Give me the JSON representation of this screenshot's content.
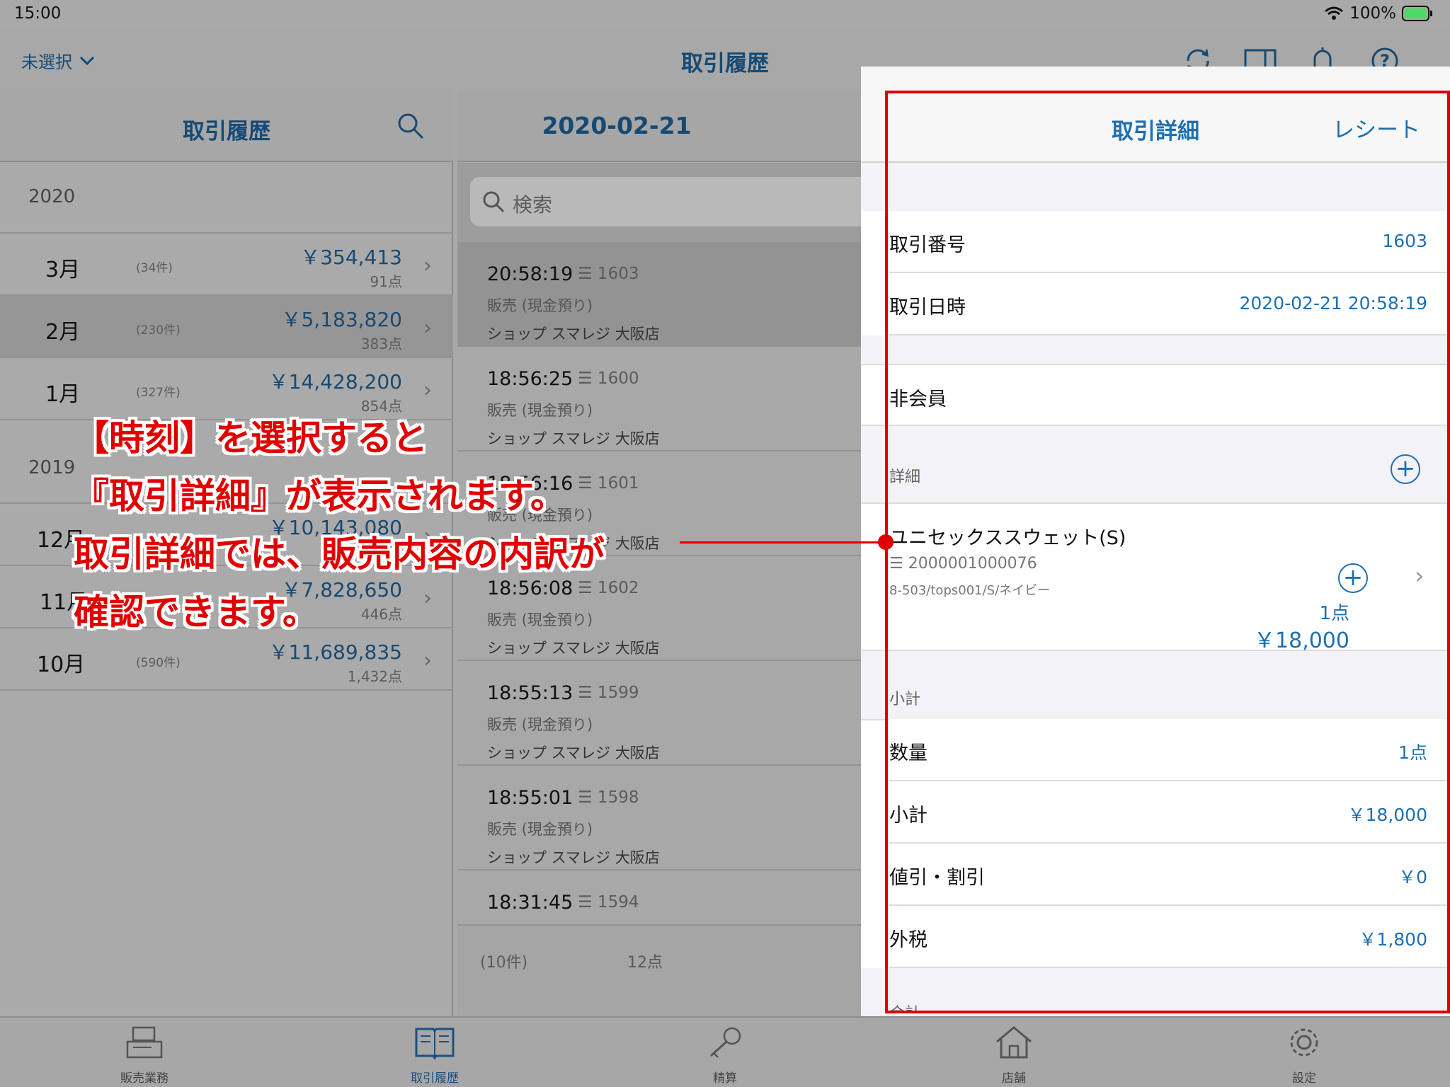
{
  "status": {
    "time": "15:00",
    "battery": "100%"
  },
  "nav": {
    "selector": "未選択",
    "title": "取引履歴",
    "icons": [
      "refresh-icon",
      "split-view-icon",
      "bell-icon",
      "help-icon"
    ]
  },
  "months": {
    "header": "取引履歴",
    "year2020": "2020",
    "year2019": "2019",
    "rows2020": [
      {
        "month": "3月",
        "count": "(34件)",
        "amount": "￥354,413",
        "points": "91点"
      },
      {
        "month": "2月",
        "count": "(230件)",
        "amount": "￥5,183,820",
        "points": "383点"
      },
      {
        "month": "1月",
        "count": "(327件)",
        "amount": "￥14,428,200",
        "points": "854点"
      }
    ],
    "rows2019": [
      {
        "month": "12月",
        "count": "",
        "amount": "￥10,143,080",
        "points": ""
      },
      {
        "month": "11月",
        "count": "",
        "amount": "￥7,828,650",
        "points": "446点"
      },
      {
        "month": "10月",
        "count": "(590件)",
        "amount": "￥11,689,835",
        "points": "1,432点"
      }
    ]
  },
  "trans": {
    "header": "2020-02-21",
    "search_placeholder": "検索",
    "rows": [
      {
        "time": "20:58:19",
        "no": "☰ 1603",
        "type": "販売 (現金預り)",
        "shop": "ショップ スマレジ 大阪店"
      },
      {
        "time": "18:56:25",
        "no": "☰ 1600",
        "type": "販売 (現金預り)",
        "shop": "ショップ スマレジ 大阪店"
      },
      {
        "time": "18:56:16",
        "no": "☰ 1601",
        "type": "販売 (現金預り)",
        "shop": "ショップ スマレジ 大阪店"
      },
      {
        "time": "18:56:08",
        "no": "☰ 1602",
        "type": "販売 (現金預り)",
        "shop": "ショップ スマレジ 大阪店"
      },
      {
        "time": "18:55:13",
        "no": "☰ 1599",
        "type": "販売 (現金預り)",
        "shop": "ショップ スマレジ 大阪店"
      },
      {
        "time": "18:55:01",
        "no": "☰ 1598",
        "type": "販売 (現金預り)",
        "shop": "ショップ スマレジ 大阪店"
      },
      {
        "time": "18:31:45",
        "no": "☰ 1594",
        "type": "販売 (現金預り)",
        "shop": ""
      }
    ],
    "footer_count": "(10件)",
    "footer_points": "12点"
  },
  "detail": {
    "title": "取引詳細",
    "receipt": "レシート",
    "rows": [
      {
        "k": "取引番号",
        "v": "1603"
      },
      {
        "k": "取引日時",
        "v": "2020-02-21 20:58:19"
      }
    ],
    "member": "非会員",
    "section_detail": "詳細",
    "item": {
      "name": "ユニセックススウェット(S)",
      "code": "☰ 2000001000076",
      "spec": "8-503/tops001/S/ネイビー",
      "qty": "1点",
      "price": "￥18,000"
    },
    "section_subtotal": "小計",
    "sum_rows": [
      {
        "k": "数量",
        "v": "1点"
      },
      {
        "k": "小計",
        "v": "￥18,000"
      },
      {
        "k": "値引・割引",
        "v": "￥0"
      },
      {
        "k": "外税",
        "v": "￥1,800"
      }
    ],
    "next_section": "合計"
  },
  "tabs": [
    "販売業務",
    "取引履歴",
    "精算",
    "店舗",
    "設定"
  ],
  "callout": "【時刻】を選択すると\n『取引詳細』が表示されます。\n取引詳細では、販売内容の内訳が\n確認できます。",
  "colors": {
    "accent": "#1e6fb0",
    "annotation": "#e00000"
  }
}
